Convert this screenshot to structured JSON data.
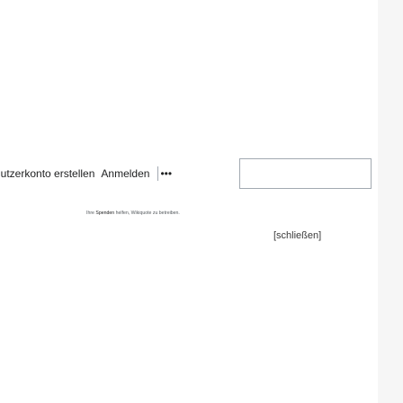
{
  "header": {
    "user_links": [
      {
        "label": "nutzerkonto erstellen"
      },
      {
        "label": "Anmelden"
      }
    ],
    "more_menu_icon": "ellipsis-icon",
    "more_menu_label": "•••"
  },
  "banner": {
    "text_prefix": "Ihre",
    "text_emphasis": "Spenden",
    "text_suffix": "helfen, Wikiquote zu betreiben.",
    "close_label": "[schließen]"
  },
  "colors": {
    "border": "#a2a9b1",
    "text": "#202122",
    "muted_text": "#54595d",
    "gutter": "#f6f6f6"
  }
}
